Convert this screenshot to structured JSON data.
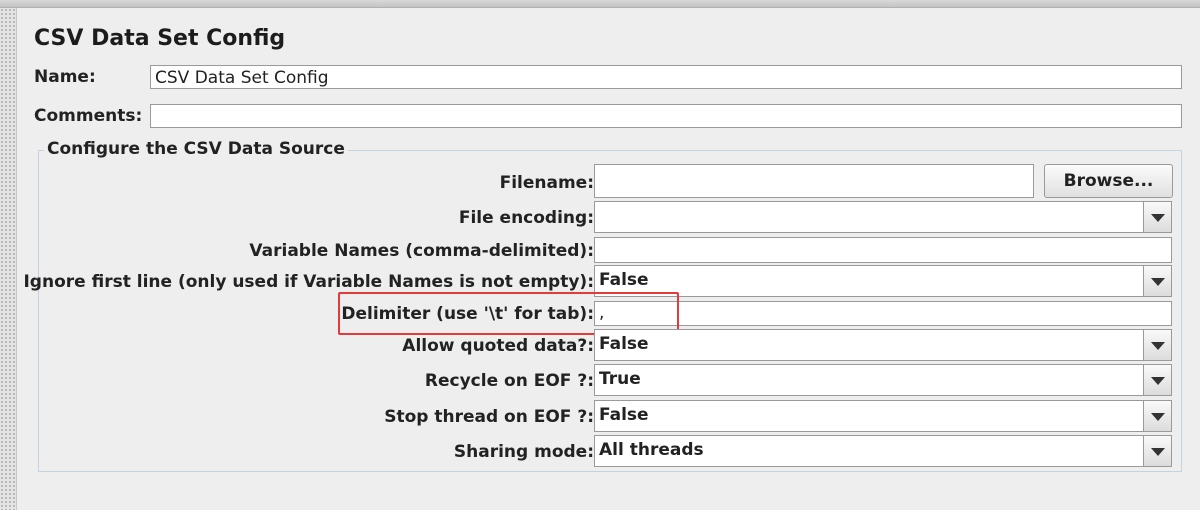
{
  "panel": {
    "title": "CSV Data Set Config",
    "name_label": "Name:",
    "name_value": "CSV Data Set Config",
    "comments_label": "Comments:",
    "comments_value": ""
  },
  "datasource": {
    "legend": "Configure the CSV Data Source",
    "filename": {
      "label": "Filename:",
      "value": ""
    },
    "browse_label": "Browse...",
    "file_encoding": {
      "label": "File encoding:",
      "value": ""
    },
    "variable_names": {
      "label": "Variable Names (comma-delimited):",
      "value": ""
    },
    "ignore_first_line": {
      "label": "Ignore first line (only used if Variable Names is not empty):",
      "value": "False"
    },
    "delimiter": {
      "label": "Delimiter (use '\\t' for tab):",
      "value": ","
    },
    "allow_quoted": {
      "label": "Allow quoted data?:",
      "value": "False"
    },
    "recycle_eof": {
      "label": "Recycle on EOF ?:",
      "value": "True"
    },
    "stop_thread_eof": {
      "label": "Stop thread on EOF ?:",
      "value": "False"
    },
    "sharing_mode": {
      "label": "Sharing mode:",
      "value": "All threads"
    }
  },
  "colors": {
    "background": "#eeeeee",
    "border_blue": "#c5d2e0",
    "highlight_red": "#e33a3a"
  },
  "icons": {
    "dropdown": "chevron-down-icon"
  }
}
